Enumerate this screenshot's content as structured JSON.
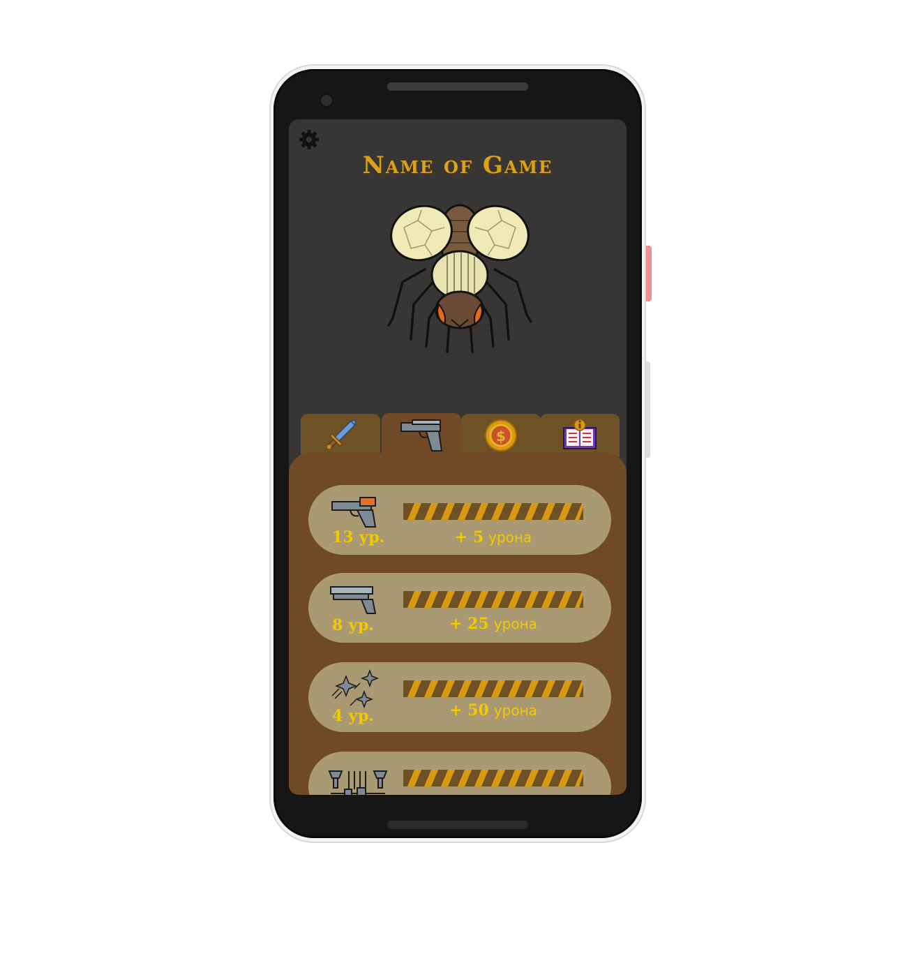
{
  "app": {
    "title": "Name of Game"
  },
  "colors": {
    "screen_bg": "#383635",
    "panel_bg": "#704a27",
    "card_bg": "#a99a74",
    "accent_gold": "#d9a11c",
    "text_yellow": "#f3c900",
    "bar_orange": "#d99a12"
  },
  "icons": {
    "settings": "gear-icon",
    "tabs": [
      "sword-icon",
      "pistol-icon",
      "coin-icon",
      "info-book-icon"
    ]
  },
  "tabs": {
    "active_index": 1
  },
  "upgrades": [
    {
      "icon": "blaster-icon",
      "level": "13 ур.",
      "bonus_prefix": "+ 5",
      "bonus_word": "урона"
    },
    {
      "icon": "shotgun-icon",
      "level": "8 ур.",
      "bonus_prefix": "+ 25",
      "bonus_word": "урона"
    },
    {
      "icon": "shuriken-icon",
      "level": "4 ур.",
      "bonus_prefix": "+ 50",
      "bonus_word": "урона"
    },
    {
      "icon": "bomb-rain-icon",
      "level": "",
      "bonus_prefix": "",
      "bonus_word": ""
    }
  ]
}
